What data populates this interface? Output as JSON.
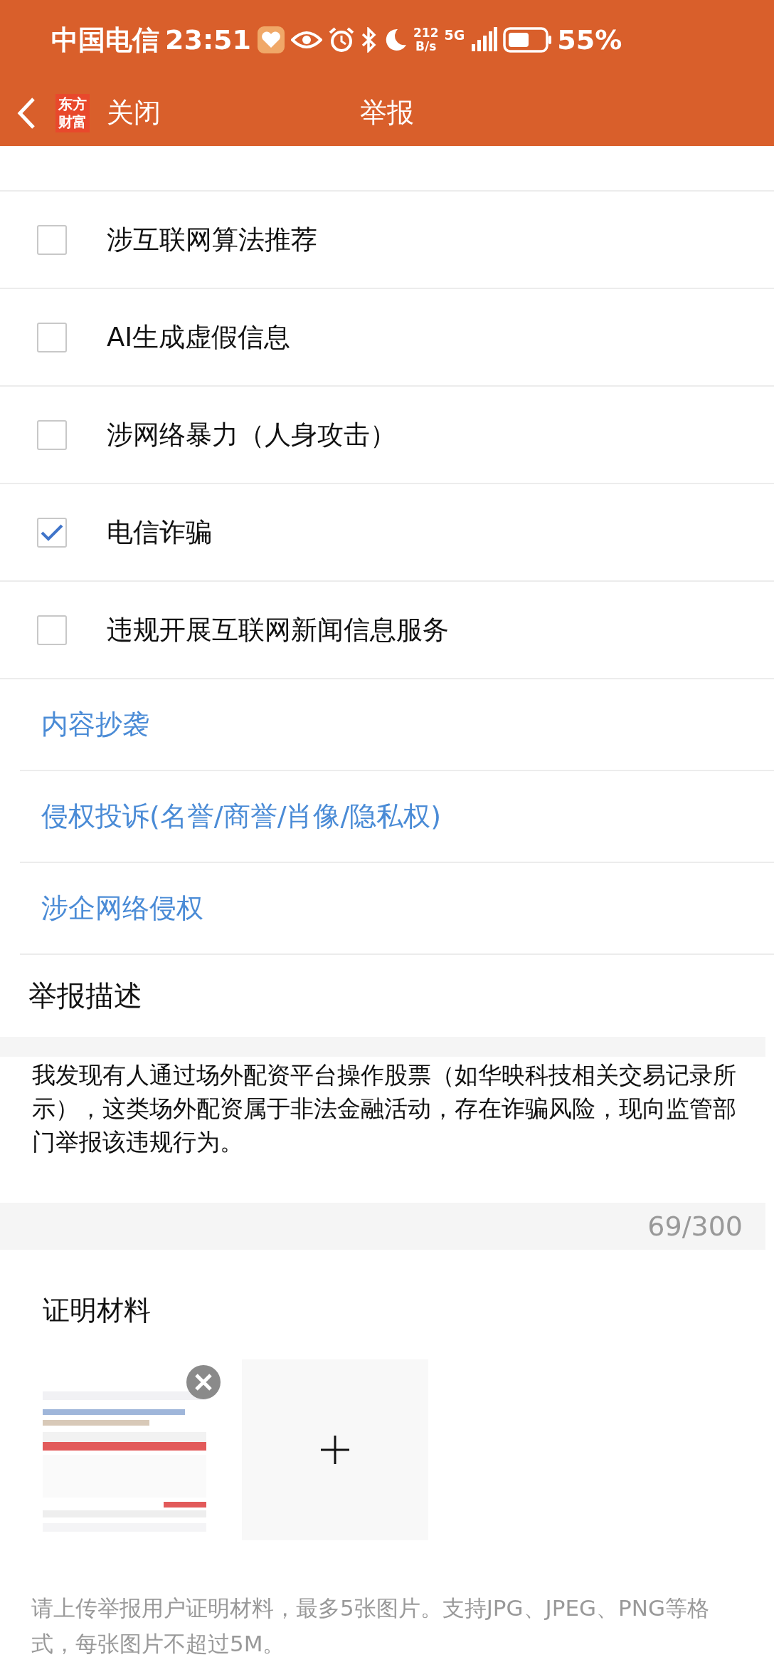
{
  "status_bar": {
    "carrier": "中国电信",
    "time": "23:51",
    "speed_value": "212",
    "speed_unit": "B/s",
    "network": "5G",
    "battery": "55%"
  },
  "header": {
    "logo_top": "东方",
    "logo_bottom": "财富",
    "close": "关闭",
    "title": "举报"
  },
  "options": [
    {
      "label": "涉互联网算法推荐",
      "checked": false
    },
    {
      "label": "AI生成虚假信息",
      "checked": false
    },
    {
      "label": "涉网络暴力（人身攻击）",
      "checked": false
    },
    {
      "label": "电信诈骗",
      "checked": true
    },
    {
      "label": "违规开展互联网新闻信息服务",
      "checked": false
    }
  ],
  "links": [
    "内容抄袭",
    "侵权投诉(名誉/商誉/肖像/隐私权)",
    "涉企网络侵权"
  ],
  "description": {
    "title": "举报描述",
    "value": "我发现有人通过场外配资平台操作股票（如华映科技相关交易记录所示），这类场外配资属于非法金融活动，存在诈骗风险，现向监管部门举报该违规行为。",
    "counter": "69/300"
  },
  "evidence": {
    "title": "证明材料"
  },
  "hint": "请上传举报用户证明材料，最多5张图片。支持JPG、JPEG、PNG等格式，每张图片不超过5M。"
}
